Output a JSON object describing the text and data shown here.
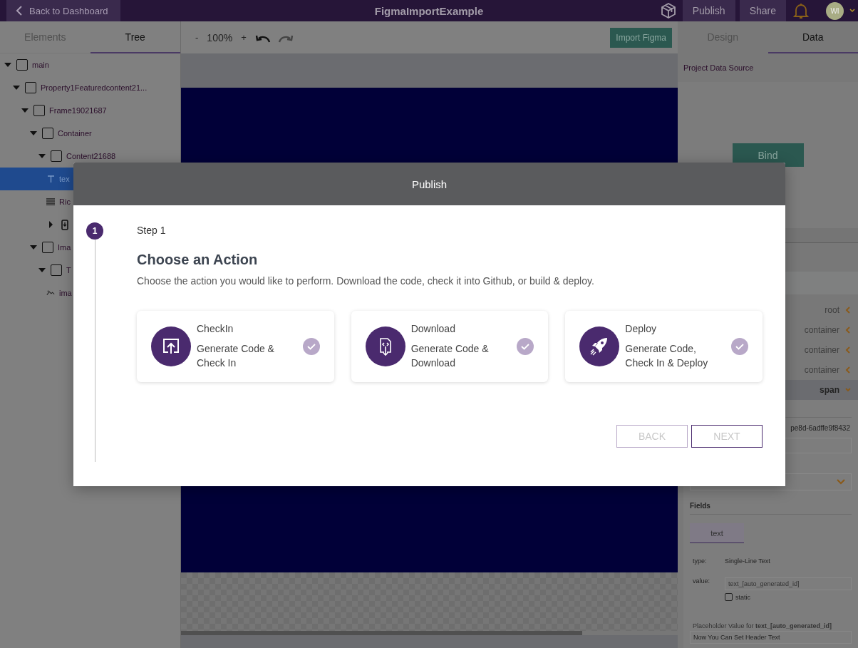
{
  "topbar": {
    "back_button": "Back to Dashboard",
    "title": "FigmaImportExample",
    "buttons": [
      "Publish",
      "Share"
    ],
    "avatar": "WI"
  },
  "left_panel": {
    "tabs": [
      {
        "label": "Elements",
        "selected": false
      },
      {
        "label": "Tree",
        "selected": true
      }
    ],
    "tree": [
      {
        "label": "main",
        "kind": "frame",
        "expanded": true,
        "selected": false,
        "children": [
          {
            "label": "Property1Featuredcontent21...",
            "kind": "frame",
            "expanded": true,
            "selected": false,
            "children": [
              {
                "label": "Frame19021687",
                "kind": "frame",
                "expanded": true,
                "selected": false,
                "children": [
                  {
                    "label": "Container",
                    "kind": "frame",
                    "expanded": true,
                    "selected": false,
                    "children": [
                      {
                        "label": "Content21688",
                        "kind": "frame",
                        "expanded": true,
                        "selected": false,
                        "children": [
                          {
                            "label": "tex",
                            "kind": "text",
                            "selected": true
                          },
                          {
                            "label": "Ric",
                            "kind": "richtext",
                            "selected": false
                          },
                          {
                            "kind": "device",
                            "expanded": false,
                            "selected": false
                          }
                        ]
                      }
                    ]
                  },
                  {
                    "label": "Ima",
                    "kind": "frame",
                    "expanded": true,
                    "selected": false,
                    "children": [
                      {
                        "label": "T",
                        "kind": "frame",
                        "expanded": true,
                        "selected": false,
                        "children": [
                          {
                            "label": "ima",
                            "kind": "image",
                            "selected": false
                          }
                        ]
                      }
                    ]
                  }
                ]
              }
            ]
          }
        ]
      }
    ]
  },
  "toolbar": {
    "zoom_out": "-",
    "zoom": "100%",
    "zoom_in": "+",
    "import_button": "Import Figma"
  },
  "right_panel": {
    "tabs": [
      {
        "label": "Design",
        "selected": false
      },
      {
        "label": "Data",
        "selected": true
      }
    ],
    "data_source_label": "Project Data Source",
    "bind_button": "Bind",
    "path": [
      {
        "label": "root",
        "expanded": false
      },
      {
        "label": "container",
        "expanded": false
      },
      {
        "label": "container",
        "expanded": false
      },
      {
        "label": "container",
        "expanded": false
      },
      {
        "label": "span",
        "expanded": true
      }
    ],
    "id_text": "pe8d-6adffe9f8432",
    "fields_heading": "Fields",
    "field_tabs": [
      {
        "label": "text",
        "selected": true
      }
    ],
    "type_label": "type:",
    "type_value": "Single-Line Text",
    "value_label": "value:",
    "value_placeholder": "text_[auto_generated_id]",
    "static": {
      "label": "static",
      "checked": false
    },
    "placeholder_label": "Placeholder Value for **text_[auto_generated_id]**",
    "placeholder_field": {
      "value": "Now You Can Set Header Text"
    }
  },
  "modal": {
    "title": "Publish",
    "steps": [
      {
        "number": "1",
        "label": "Step 1"
      }
    ],
    "heading": "Choose an Action",
    "description": "Choose the action you would like to perform. Download the code, check it into Github, or build & deploy.",
    "actions": [
      {
        "kind": "checkin",
        "title": "CheckIn",
        "description": "Generate Code & Check In",
        "selected": false
      },
      {
        "kind": "download",
        "title": "Download",
        "description": "Generate Code & Download",
        "selected": false
      },
      {
        "kind": "deploy",
        "title": "Deploy",
        "description": "Generate Code, Check In & Deploy",
        "selected": false
      }
    ],
    "buttons": [
      {
        "label": "BACK",
        "disabled": true
      },
      {
        "label": "NEXT",
        "disabled": true
      }
    ]
  }
}
